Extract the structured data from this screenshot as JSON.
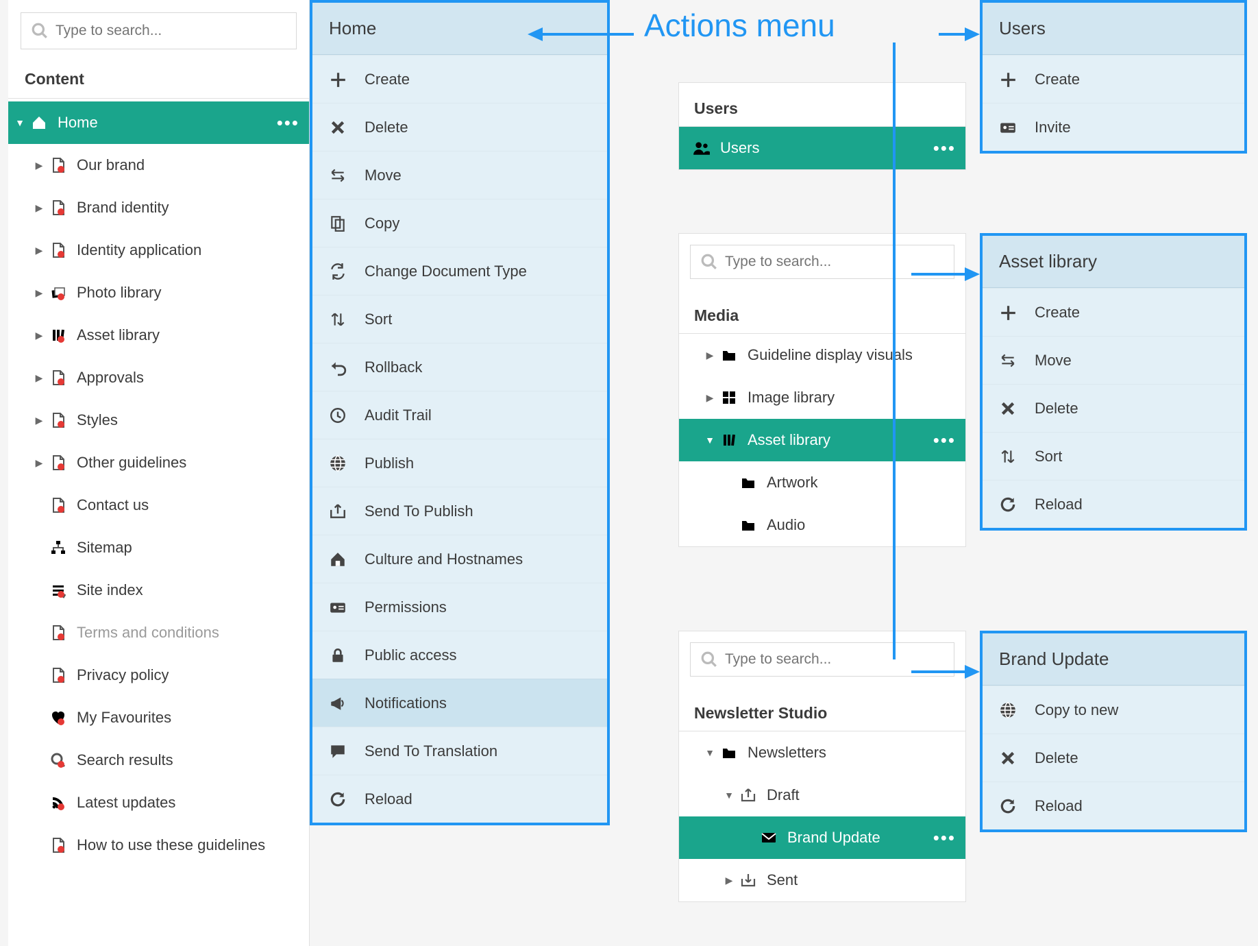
{
  "callout_title": "Actions menu",
  "search_placeholder": "Type to search...",
  "content": {
    "heading": "Content",
    "home_label": "Home",
    "items": [
      {
        "label": "Our brand",
        "expand": true,
        "icon": "doc",
        "red": true
      },
      {
        "label": "Brand identity",
        "expand": true,
        "icon": "doc",
        "red": true
      },
      {
        "label": "Identity application",
        "expand": true,
        "icon": "doc",
        "red": true
      },
      {
        "label": "Photo library",
        "expand": true,
        "icon": "photos",
        "red": true
      },
      {
        "label": "Asset library",
        "expand": true,
        "icon": "library",
        "red": true
      },
      {
        "label": "Approvals",
        "expand": true,
        "icon": "doc",
        "red": true
      },
      {
        "label": "Styles",
        "expand": true,
        "icon": "doc",
        "red": true
      },
      {
        "label": "Other guidelines",
        "expand": true,
        "icon": "doc",
        "red": true
      },
      {
        "label": "Contact us",
        "expand": false,
        "icon": "doc",
        "red": true
      },
      {
        "label": "Sitemap",
        "expand": false,
        "icon": "sitemap",
        "red": false
      },
      {
        "label": "Site index",
        "expand": false,
        "icon": "index",
        "red": true
      },
      {
        "label": "Terms and conditions",
        "expand": false,
        "icon": "doc",
        "red": true,
        "dim": true
      },
      {
        "label": "Privacy policy",
        "expand": false,
        "icon": "doc",
        "red": true
      },
      {
        "label": "My Favourites",
        "expand": false,
        "icon": "heart",
        "red": true
      },
      {
        "label": "Search results",
        "expand": false,
        "icon": "search",
        "red": true
      },
      {
        "label": "Latest updates",
        "expand": false,
        "icon": "rss",
        "red": true
      },
      {
        "label": "How to use these guidelines",
        "expand": false,
        "icon": "doc",
        "red": true
      }
    ]
  },
  "menu_home": {
    "title": "Home",
    "items": [
      {
        "icon": "plus",
        "label": "Create"
      },
      {
        "icon": "x",
        "label": "Delete"
      },
      {
        "icon": "move",
        "label": "Move"
      },
      {
        "icon": "copy",
        "label": "Copy"
      },
      {
        "icon": "swap",
        "label": "Change Document Type"
      },
      {
        "icon": "sort",
        "label": "Sort"
      },
      {
        "icon": "rollback",
        "label": "Rollback"
      },
      {
        "icon": "clock",
        "label": "Audit Trail"
      },
      {
        "icon": "globe",
        "label": "Publish"
      },
      {
        "icon": "outbox",
        "label": "Send To Publish"
      },
      {
        "icon": "house",
        "label": "Culture and Hostnames"
      },
      {
        "icon": "idcard",
        "label": "Permissions"
      },
      {
        "icon": "lock",
        "label": "Public access"
      },
      {
        "icon": "megaphone",
        "label": "Notifications",
        "highlight": true
      },
      {
        "icon": "speech",
        "label": "Send To Translation"
      },
      {
        "icon": "reload",
        "label": "Reload"
      }
    ]
  },
  "users_panel": {
    "heading": "Users",
    "active_label": "Users"
  },
  "menu_users": {
    "title": "Users",
    "items": [
      {
        "icon": "plus",
        "label": "Create"
      },
      {
        "icon": "idcard",
        "label": "Invite"
      }
    ]
  },
  "media_panel": {
    "heading": "Media",
    "items": [
      {
        "label": "Guideline display visuals",
        "icon": "folder",
        "expand": true,
        "indent": 1
      },
      {
        "label": "Image library",
        "icon": "gallery",
        "expand": true,
        "indent": 1
      },
      {
        "label": "Asset library",
        "icon": "library",
        "expand": true,
        "indent": 1,
        "active": true
      },
      {
        "label": "Artwork",
        "icon": "folder",
        "expand": false,
        "indent": 2
      },
      {
        "label": "Audio",
        "icon": "folder",
        "expand": false,
        "indent": 2
      }
    ]
  },
  "menu_asset": {
    "title": "Asset library",
    "items": [
      {
        "icon": "plus",
        "label": "Create"
      },
      {
        "icon": "move",
        "label": "Move"
      },
      {
        "icon": "x",
        "label": "Delete"
      },
      {
        "icon": "sort",
        "label": "Sort"
      },
      {
        "icon": "reload",
        "label": "Reload"
      }
    ]
  },
  "newsletter_panel": {
    "heading": "Newsletter Studio",
    "items": [
      {
        "label": "Newsletters",
        "icon": "folder",
        "expand": true,
        "indent": 1,
        "caret": "down"
      },
      {
        "label": "Draft",
        "icon": "outbox",
        "expand": true,
        "indent": 2,
        "caret": "down"
      },
      {
        "label": "Brand Update",
        "icon": "mail",
        "expand": false,
        "indent": 3,
        "active": true
      },
      {
        "label": "Sent",
        "icon": "inbox",
        "expand": true,
        "indent": 2
      }
    ]
  },
  "menu_brand": {
    "title": "Brand Update",
    "items": [
      {
        "icon": "globe",
        "label": "Copy to new"
      },
      {
        "icon": "x",
        "label": "Delete"
      },
      {
        "icon": "reload",
        "label": "Reload"
      }
    ]
  }
}
